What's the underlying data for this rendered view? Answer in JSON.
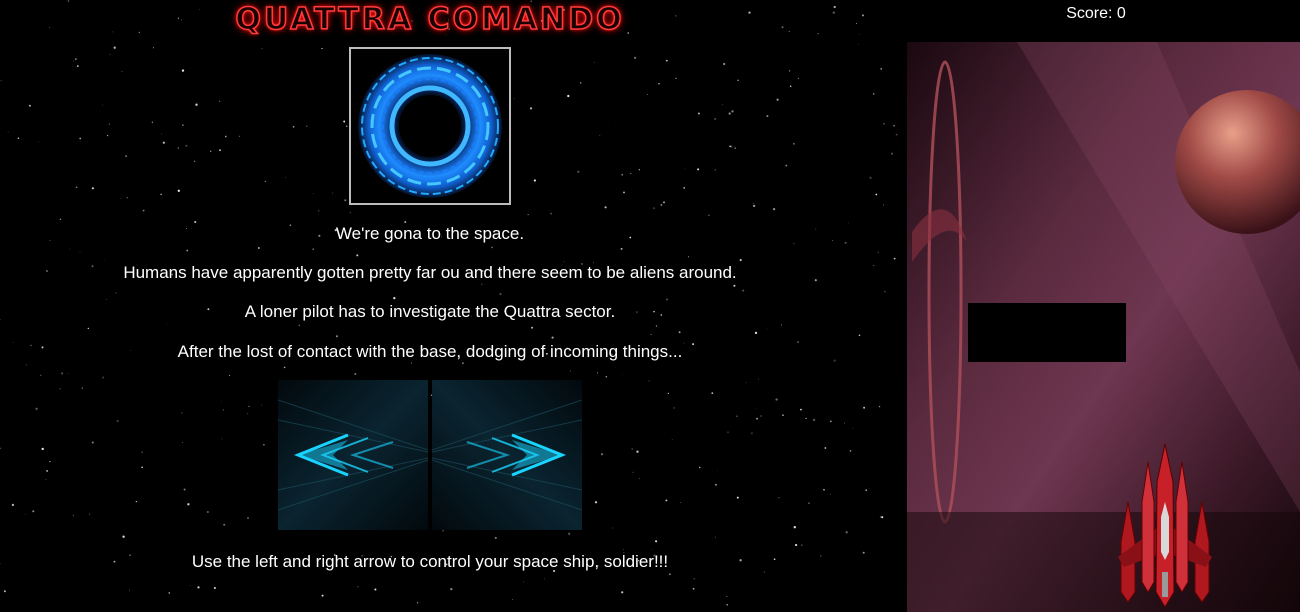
{
  "game": {
    "title": "QUATTRA COMANDO",
    "score_text": "Score: 0"
  },
  "story": {
    "lines": [
      "We're gona to the space.",
      "Humans have apparently gotten pretty far ou and there seem to be aliens around.",
      "A loner pilot has to investigate the Quattra sector.",
      "After the lost of contact with the base, dodging of incoming things..."
    ],
    "instructions": "Use the left and right arrow to control your space ship, soldier!!!"
  },
  "controls": {
    "left_icon": "left-arrow-icon",
    "right_icon": "right-arrow-icon"
  },
  "colors": {
    "title_red": "#ff3b3b",
    "portal_blue": "#1ea0ff",
    "arrow_cyan": "#19d4ff",
    "game_bg": "#2a0f1c",
    "ship_red": "#c8202a"
  }
}
